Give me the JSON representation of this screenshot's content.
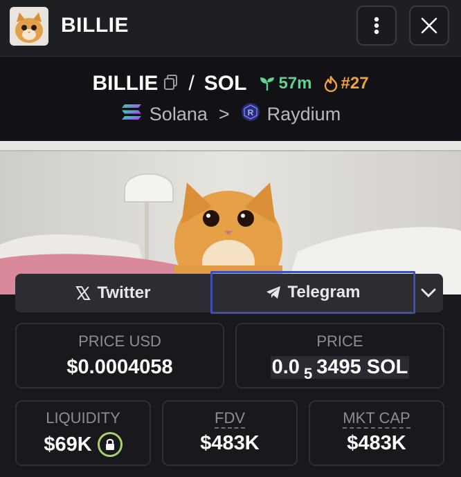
{
  "header": {
    "title": "BILLIE",
    "menu_icon": "kebab-menu-icon",
    "close_icon": "close-icon"
  },
  "pair": {
    "base": "BILLIE",
    "separator": "/",
    "quote": "SOL",
    "age": "57m",
    "rank": "#27",
    "chain": "Solana",
    "chevron": ">",
    "dex": "Raydium",
    "colors": {
      "age": "#5fd38d",
      "rank": "#f6a23a"
    }
  },
  "links": {
    "twitter": "Twitter",
    "telegram": "Telegram"
  },
  "stats": {
    "price_usd_label": "PRICE USD",
    "price_usd_value": "$0.0004058",
    "price_label": "PRICE",
    "price_prefix": "0.0",
    "price_zeros": "5",
    "price_digits": "3495 SOL",
    "liquidity_label": "LIQUIDITY",
    "liquidity_value": "$69K",
    "fdv_label": "FDV",
    "fdv_value": "$483K",
    "mktcap_label": "MKT CAP",
    "mktcap_value": "$483K"
  }
}
